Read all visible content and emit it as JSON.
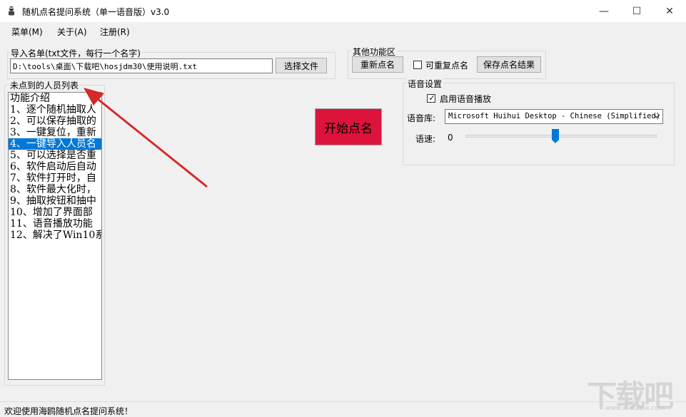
{
  "window": {
    "title": "随机点名提问系统（单一语音版）v3.0",
    "minimize_glyph": "—",
    "maximize_glyph": "☐",
    "close_glyph": "✕"
  },
  "menu": [
    "菜单(M)",
    "关于(A)",
    "注册(R)"
  ],
  "import": {
    "group_label": "导入名单(txt文件，每行一个名字)",
    "path_value": "D:\\tools\\桌面\\下载吧\\hosjdm30\\使用说明.txt",
    "browse_button": "选择文件"
  },
  "other": {
    "group_label": "其他功能区",
    "reset_button": "重新点名",
    "repeat_checkbox_label": "可重复点名",
    "repeat_checked": false,
    "save_button": "保存点名结果"
  },
  "list": {
    "group_label": "未点到的人员列表",
    "items": [
      "功能介绍",
      "1、逐个随机抽取人",
      "2、可以保存抽取的",
      "3、一键复位，重新",
      "4、一键导入人员名",
      "5、可以选择是否重",
      "6、软件启动后自动",
      "7、软件打开时，自",
      "8、软件最大化时，",
      "9、抽取按钮和抽中",
      "10、增加了界面部",
      "11、语音播放功能",
      "12、解决了Win10系"
    ],
    "selected_index": 4
  },
  "start_button": "开始点名",
  "voice": {
    "group_label": "语音设置",
    "enable_label": "启用语音播放",
    "enable_checked": true,
    "library_label": "语音库:",
    "library_value": "Microsoft Huihui Desktop - Chinese (Simplified)",
    "speed_label": "语速:",
    "speed_value": "0",
    "speed_fraction": 0.47
  },
  "status": {
    "text": "欢迎使用海鸥随机点名提问系统！"
  },
  "watermark": {
    "main": "下载吧",
    "sub": "www.xiazaiba.com"
  },
  "colors": {
    "start_button_bg": "#dc143c",
    "selection": "#0078d7",
    "arrow": "#d42a2a",
    "thumb": "#0078d7"
  }
}
